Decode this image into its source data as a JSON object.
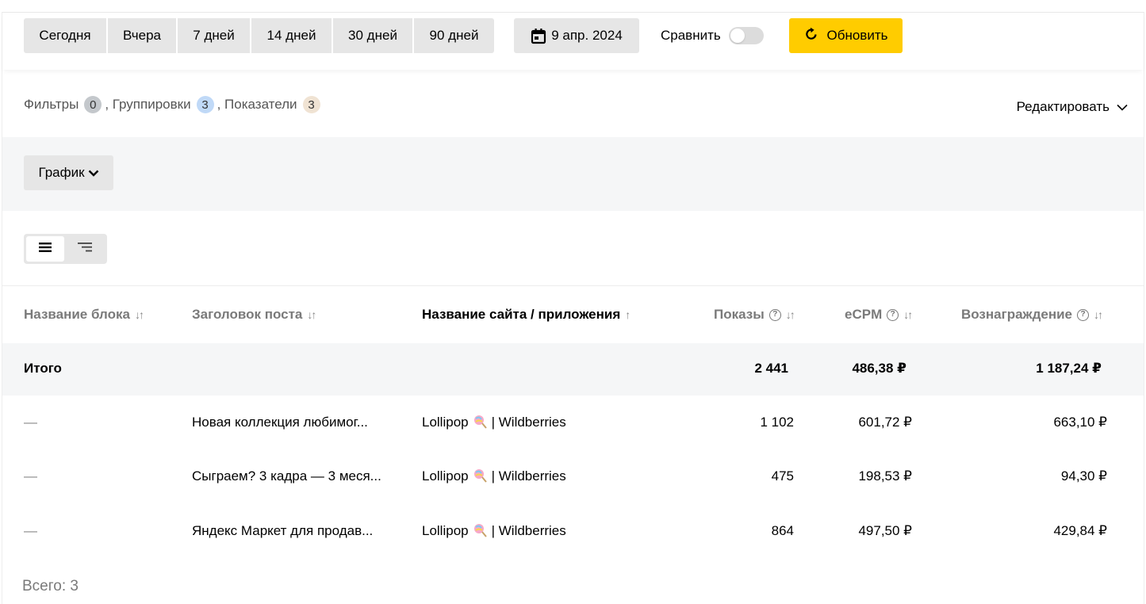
{
  "toolbar": {
    "periods": [
      "Сегодня",
      "Вчера",
      "7 дней",
      "14 дней",
      "30 дней",
      "90 дней"
    ],
    "date_label": "9 апр. 2024",
    "compare_label": "Сравнить",
    "compare_enabled": false,
    "refresh_label": "Обновить",
    "accent_color": "#ffcc00"
  },
  "filters": {
    "filters_label": "Фильтры",
    "filters_count": "0",
    "groupings_label": ", Группировки",
    "groupings_count": "3",
    "metrics_label": ", Показатели",
    "metrics_count": "3",
    "edit_label": "Редактировать"
  },
  "chart_section": {
    "button_label": "График"
  },
  "view_switch": {
    "selected": "list"
  },
  "table": {
    "columns": [
      {
        "label": "Название блока",
        "sort": "↓↑"
      },
      {
        "label": "Заголовок поста",
        "sort": "↓↑"
      },
      {
        "label": "Название сайта / приложения",
        "sort": "↑"
      },
      {
        "label": "Показы",
        "sort": "↓↑"
      },
      {
        "label": "eCPM",
        "sort": "↓↑"
      },
      {
        "label": "Вознаграждение",
        "sort": "↓↑"
      }
    ],
    "total": {
      "label": "Итого",
      "shows": "2 441",
      "ecpm": "486,38 ₽",
      "reward": "1 187,24 ₽"
    },
    "rows": [
      {
        "block": "—",
        "post": "Новая коллекция любимог...",
        "site_before": "Lollipop",
        "site_after": "| Wildberries",
        "shows": "1 102",
        "ecpm": "601,72 ₽",
        "reward": "663,10 ₽"
      },
      {
        "block": "—",
        "post": "Сыграем? 3 кадра — 3 меся...",
        "site_before": "Lollipop",
        "site_after": "| Wildberries",
        "shows": "475",
        "ecpm": "198,53 ₽",
        "reward": "94,30 ₽"
      },
      {
        "block": "—",
        "post": "Яндекс Маркет для продав...",
        "site_before": "Lollipop",
        "site_after": "| Wildberries",
        "shows": "864",
        "ecpm": "497,50 ₽",
        "reward": "429,84 ₽"
      }
    ],
    "footer": "Всего: 3"
  }
}
